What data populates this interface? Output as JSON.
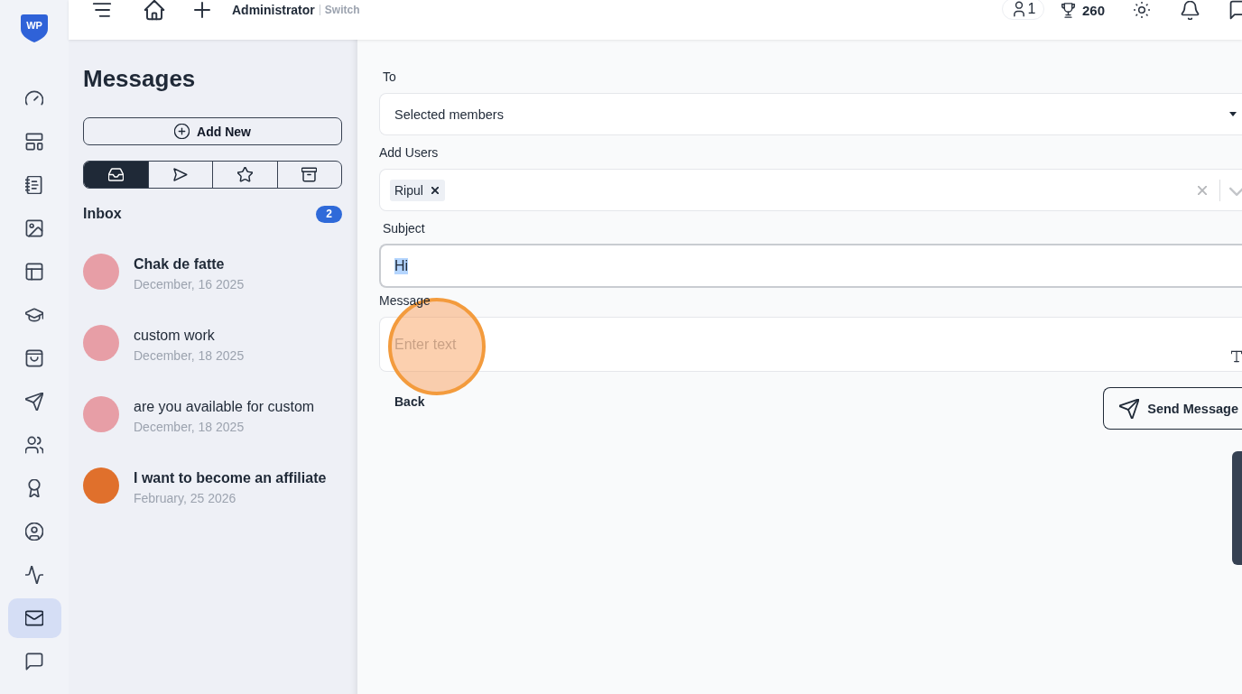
{
  "app": {
    "logo_text": "WP"
  },
  "sidebar": {
    "items": [
      {
        "selected": false
      },
      {
        "selected": false
      },
      {
        "selected": false
      },
      {
        "selected": false
      },
      {
        "selected": false
      },
      {
        "selected": false
      },
      {
        "selected": false
      },
      {
        "selected": false
      },
      {
        "selected": false
      },
      {
        "selected": false
      },
      {
        "selected": false
      },
      {
        "selected": false
      },
      {
        "selected": true
      },
      {
        "selected": false
      }
    ]
  },
  "topbar": {
    "user_role": "Administrator",
    "switch_link": "Switch",
    "online_users": "1",
    "points": "260"
  },
  "messages_panel": {
    "title": "Messages",
    "add_button": "Add New",
    "folder_tabs": [
      {
        "selected": true
      },
      {
        "selected": false
      },
      {
        "selected": false
      },
      {
        "selected": false
      }
    ],
    "folder_title": "Inbox",
    "unread_count": "2",
    "conversations": [
      {
        "subject": "Chak de fatte",
        "date": "December, 16 2025",
        "unread": true,
        "color": "#e79ea6"
      },
      {
        "subject": "custom work",
        "date": "December, 18 2025",
        "unread": false,
        "color": "#e79ea6"
      },
      {
        "subject": "are you available for custom",
        "date": "December, 18 2025",
        "unread": false,
        "color": "#e79ea6"
      },
      {
        "subject": "I want to become an affiliate",
        "date": "February, 25 2026",
        "unread": true,
        "color": "#e0702c"
      }
    ]
  },
  "compose": {
    "to": {
      "label": "To",
      "value": "Selected members"
    },
    "add_users": {
      "label": "Add Users",
      "chips": [
        {
          "label": "Ripul"
        }
      ]
    },
    "subject": {
      "label": "Subject",
      "value": "Hi",
      "focused": true,
      "value_selected": true
    },
    "message": {
      "label": "Message",
      "placeholder": "Enter text"
    },
    "back_button": "Back",
    "send_button": "Send Message"
  }
}
